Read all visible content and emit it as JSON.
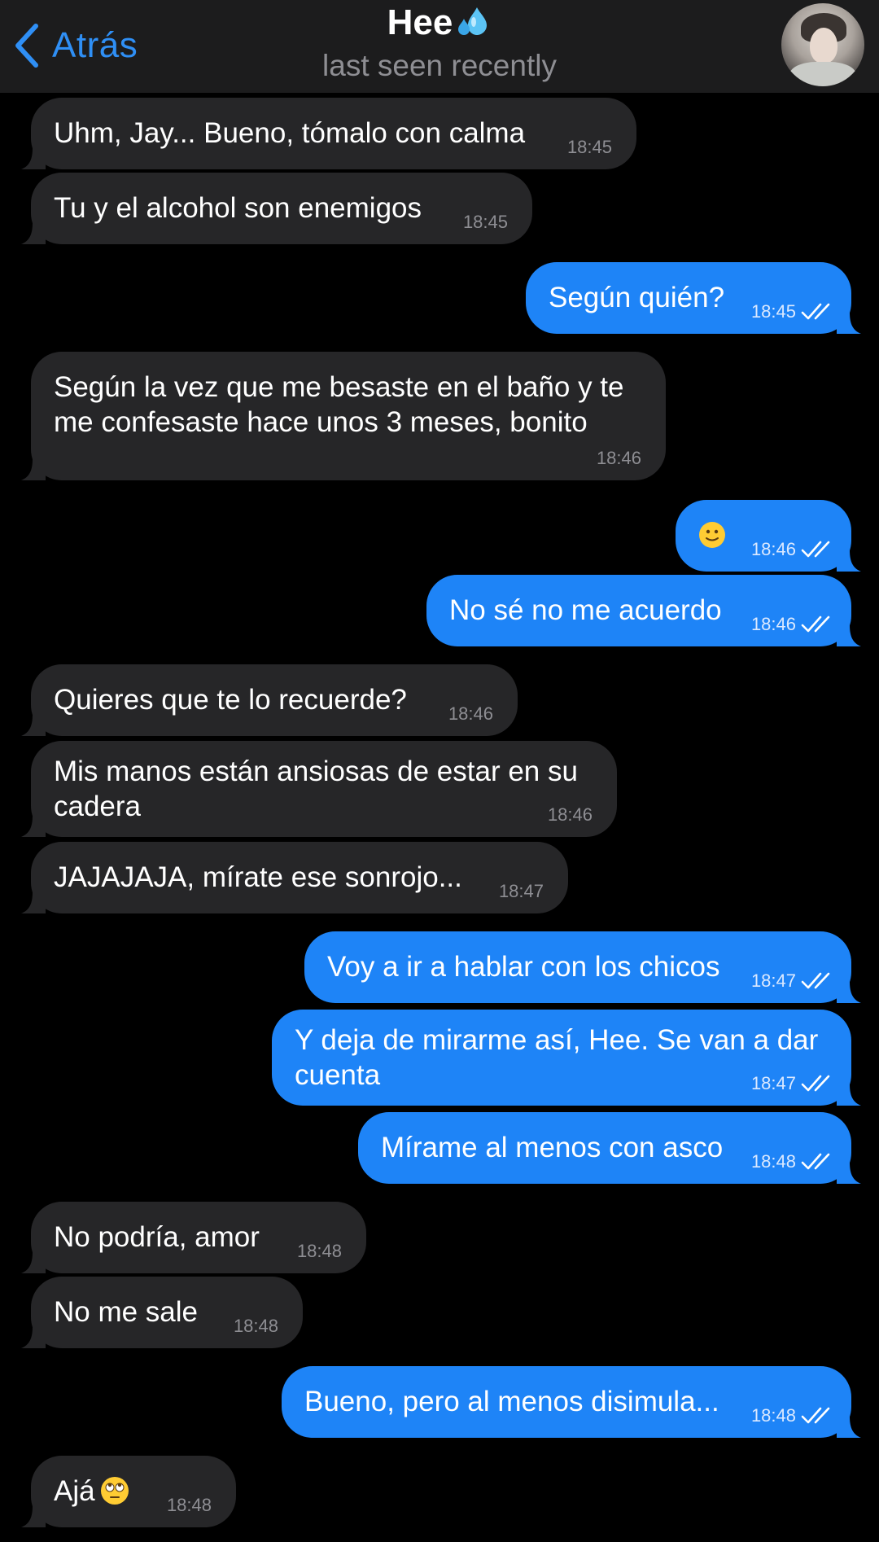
{
  "header": {
    "back_label": "Atrás",
    "title": "Hee",
    "title_emoji": "sweat-droplets-emoji",
    "status": "last seen recently"
  },
  "colors": {
    "accent": "#2f8ff5",
    "outgoing_bubble": "#1e84f7",
    "incoming_bubble": "#262628",
    "background": "#000000",
    "header": "#1c1c1d"
  },
  "messages": [
    {
      "dir": "in",
      "text": "Uhm, Jay... Bueno, tómalo con calma",
      "time": "18:45"
    },
    {
      "dir": "in",
      "text": "Tu y el alcohol son enemigos",
      "time": "18:45"
    },
    {
      "dir": "out",
      "text": "Según quién?",
      "time": "18:45",
      "read": true
    },
    {
      "dir": "in",
      "text": "Según la vez que me besaste en el baño y te\nme confesaste hace unos 3 meses, bonito",
      "time": "18:46"
    },
    {
      "dir": "out",
      "text": "",
      "emoji": "slightly-smiling-face-emoji",
      "time": "18:46",
      "read": true
    },
    {
      "dir": "out",
      "text": "No sé no me acuerdo",
      "time": "18:46",
      "read": true
    },
    {
      "dir": "in",
      "text": "Quieres que te lo recuerde?",
      "time": "18:46"
    },
    {
      "dir": "in",
      "text": "Mis manos están ansiosas de estar en su\ncadera",
      "time": "18:46"
    },
    {
      "dir": "in",
      "text": "JAJAJAJA, mírate ese sonrojo...",
      "time": "18:47"
    },
    {
      "dir": "out",
      "text": "Voy a ir a hablar con los chicos",
      "time": "18:47",
      "read": true
    },
    {
      "dir": "out",
      "text": "Y deja de mirarme así, Hee. Se van a dar\ncuenta",
      "time": "18:47",
      "read": true
    },
    {
      "dir": "out",
      "text": "Mírame al menos con asco",
      "time": "18:48",
      "read": true
    },
    {
      "dir": "in",
      "text": "No podría, amor",
      "time": "18:48"
    },
    {
      "dir": "in",
      "text": "No me sale",
      "time": "18:48"
    },
    {
      "dir": "out",
      "text": "Bueno, pero al menos disimula...",
      "time": "18:48",
      "read": true
    },
    {
      "dir": "in",
      "text": "Ajá",
      "emoji": "rolling-eyes-emoji",
      "time": "18:48"
    }
  ]
}
